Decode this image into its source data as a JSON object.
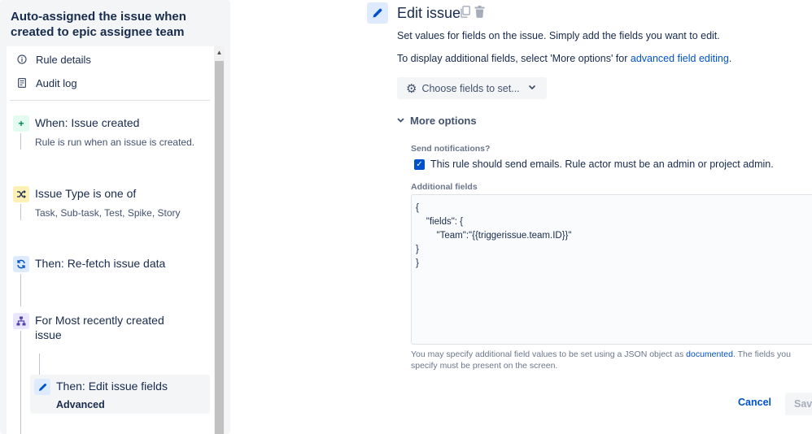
{
  "rule": {
    "title": "Auto-assigned the issue when created to epic assignee team"
  },
  "nav": [
    {
      "label": "Rule details",
      "icon": "info-icon"
    },
    {
      "label": "Audit log",
      "icon": "audit-log-icon"
    }
  ],
  "steps": [
    {
      "title": "When: Issue created",
      "subtitle": "Rule is run when an issue is created.",
      "icon": "plus-icon"
    },
    {
      "title": "Issue Type is one of",
      "subtitle": "Task, Sub-task, Test, Spike, Story",
      "icon": "shuffle-icon"
    },
    {
      "title": "Then: Re-fetch issue data",
      "icon": "refresh-icon"
    },
    {
      "title": "For Most recently created issue",
      "icon": "branch-icon"
    },
    {
      "title": "Then: Edit issue fields",
      "subtitle": "Advanced",
      "icon": "pencil-icon",
      "selected": true
    }
  ],
  "editor": {
    "title": "Edit issue",
    "description": "Set values for fields on the issue. Simply add the fields you want to edit.",
    "additional_prefix": "To display additional fields, select 'More options' for ",
    "additional_link": "advanced field editing",
    "additional_suffix": ".",
    "choose_fields": "Choose fields to set...",
    "more_options": "More options",
    "send_notifications_label": "Send notifications?",
    "send_notifications_checked": true,
    "send_notifications_text": "This rule should send emails. Rule actor must be an admin or project admin.",
    "additional_fields_label": "Additional fields",
    "additional_fields_value": "{\n    \"fields\": {\n        \"Team\":\"{{triggerissue.team.ID}}\"\n}\n}",
    "help_prefix": "You may specify additional field values to be set using a JSON object as ",
    "help_link": "documented",
    "help_suffix": ". The fields you specify must be present on the screen.",
    "cancel": "Cancel",
    "save": "Save"
  },
  "colors": {
    "accent": "#0052cc",
    "text": "#172b4d",
    "panel": "#f4f5f7"
  }
}
